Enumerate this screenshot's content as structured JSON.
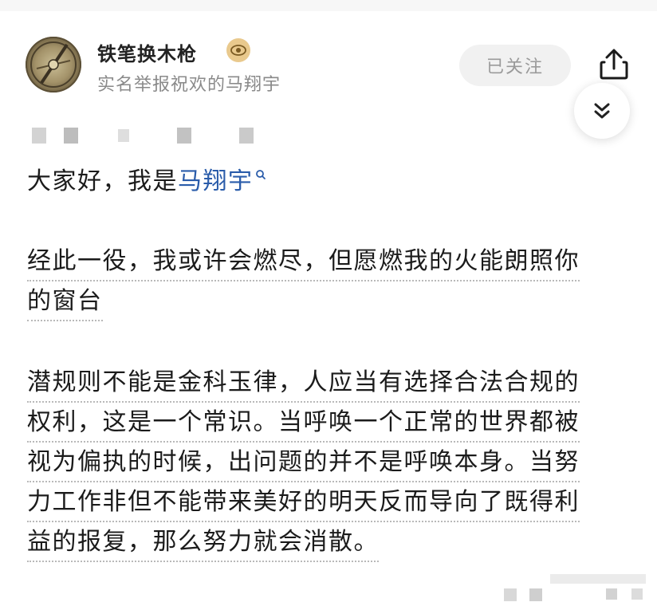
{
  "header": {
    "username": "铁笔换木枪",
    "subtitle": "实名举报祝欢的马翔宇",
    "follow_label": "已关注",
    "icons": {
      "badge": "verified-eye-icon",
      "share": "share-icon",
      "expand": "double-chevron-down-icon"
    }
  },
  "post": {
    "greeting_prefix": "大家好，我是",
    "greeting_name": "马翔宇",
    "para1": [
      "经此一役，我或许会燃尽，但愿燃我的火能朗照你",
      "的窗台"
    ],
    "para2": [
      "潜规则不能是金科玉律，人应当有选择合法合规的",
      "权利，这是一个常识。当呼唤一个正常的世界都被",
      "视为偏执的时候，出问题的并不是呼唤本身。当努",
      "力工作非但不能带来美好的明天反而导向了既得利",
      "益的报复，那么努力就会消散。"
    ]
  },
  "colors": {
    "link": "#2a5caa",
    "badge": "#e9c98d"
  }
}
